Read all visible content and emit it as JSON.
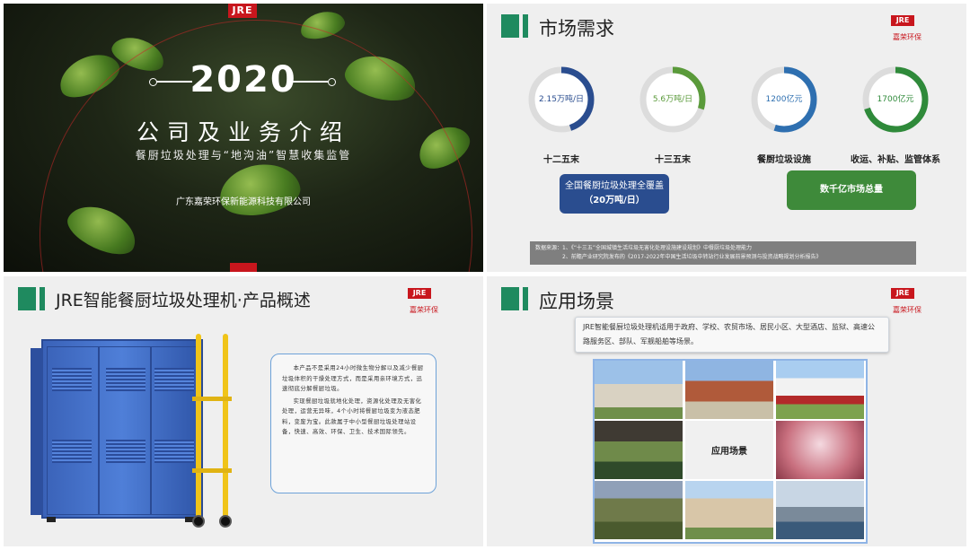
{
  "colors": {
    "brand_red": "#c8161d",
    "accent_green": "#1f8a5f",
    "blue": "#2a4d8f",
    "green": "#3e8a3a"
  },
  "slide1": {
    "logo": "JRE",
    "year": "2020",
    "title": "公司及业务介绍",
    "subtitle": "餐厨垃圾处理与“地沟油”智慧收集监管",
    "company": "广东嘉荣环保新能源科技有限公司"
  },
  "header_logo": {
    "mark": "JRE",
    "cn": "嘉荣环保"
  },
  "slide2": {
    "title": "市场需求",
    "gauges": [
      {
        "value": "2.15万吨/日",
        "label": "十二五末",
        "color": "#2a4d8f",
        "fill": 0.45
      },
      {
        "value": "5.6万吨/日",
        "label": "十三五末",
        "color": "#5a9a3a",
        "fill": 0.3
      },
      {
        "value": "1200亿元",
        "label": "餐厨垃圾设施",
        "color": "#2e6fb0",
        "fill": 0.55
      },
      {
        "value": "1700亿元",
        "label": "收运、补贴、监管体系",
        "color": "#2f8a3a",
        "fill": 0.7
      }
    ],
    "blue_button": {
      "line1": "全国餐厨垃圾处理全覆盖",
      "line2": "（20万吨/日）"
    },
    "green_button": "数千亿市场总量",
    "source": {
      "line1": "数据来源：1、《“十三五”全国城镇生活垃圾无害化处理设施建设规划》中餐厨垃圾处理能力",
      "line2": "2、前瞻产业研究院发布的《2017-2022年中国生活垃圾中转站行业发展前景预测与投资战略规划分析报告》"
    }
  },
  "slide3": {
    "title": "JRE智能餐厨垃圾处理机·产品概述",
    "paragraphs": [
      "本产品不是采用24小时微生物分解以及减少餐厨垃圾体积的干燥处理方式，而是采用亲环境方式，迅速彻底分解餐厨垃圾。",
      "实现餐厨垃圾就地化处理，资源化处理及无害化处理，运营无异味，4个小时将餐厨垃圾变为液态肥料，变废为宝。此款属于中小型餐厨垃圾处理站设备，快速、高效、环保、卫生、技术国际领先。"
    ]
  },
  "slide4": {
    "title": "应用场景",
    "intro": "JRE智能餐厨垃圾处理机适用于政府、学校、农贸市场、居民小区、大型酒店、监狱、高速公路服务区、部队、军舰船舶等场景。",
    "center_label": "应用场景"
  }
}
